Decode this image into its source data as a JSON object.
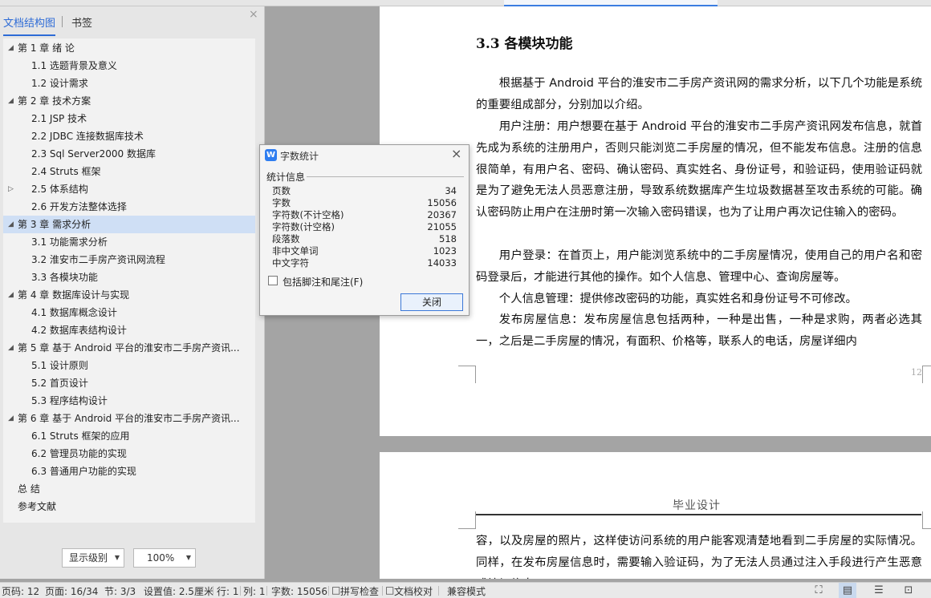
{
  "nav": {
    "tab_toc": "文档结构图",
    "tab_bookmark": "书签",
    "close": "×",
    "items": [
      {
        "twisty": "◢",
        "label": "第 1 章  绪  论"
      },
      {
        "twisty": "",
        "label": "1.1 选题背景及意义"
      },
      {
        "twisty": "",
        "label": "1.2 设计需求"
      },
      {
        "twisty": "◢",
        "label": "第 2 章  技术方案"
      },
      {
        "twisty": "",
        "label": "2.1 JSP 技术"
      },
      {
        "twisty": "",
        "label": "2.2 JDBC 连接数据库技术"
      },
      {
        "twisty": "",
        "label": "2.3 Sql Server2000 数据库"
      },
      {
        "twisty": "",
        "label": "2.4 Struts 框架"
      },
      {
        "twisty": "▷",
        "label": "2.5  体系结构"
      },
      {
        "twisty": "",
        "label": "2.6  开发方法整体选择"
      },
      {
        "twisty": "◢",
        "label": "第 3 章  需求分析"
      },
      {
        "twisty": "",
        "label": "3.1 功能需求分析"
      },
      {
        "twisty": "",
        "label": "3.2  淮安市二手房产资讯网流程"
      },
      {
        "twisty": "",
        "label": "3.3  各模块功能"
      },
      {
        "twisty": "◢",
        "label": "第 4 章  数据库设计与实现"
      },
      {
        "twisty": "",
        "label": "4.1 数据库概念设计"
      },
      {
        "twisty": "",
        "label": "4.2 数据库表结构设计"
      },
      {
        "twisty": "◢",
        "label": "第 5 章  基于 Android 平台的淮安市二手房产资讯..."
      },
      {
        "twisty": "",
        "label": "5.1  设计原则"
      },
      {
        "twisty": "",
        "label": "5.2  首页设计"
      },
      {
        "twisty": "",
        "label": "5.3  程序结构设计"
      },
      {
        "twisty": "◢",
        "label": "第 6 章  基于 Android 平台的淮安市二手房产资讯..."
      },
      {
        "twisty": "",
        "label": "6.1 Struts 框架的应用"
      },
      {
        "twisty": "",
        "label": "6.2 管理员功能的实现"
      },
      {
        "twisty": "",
        "label": "6.3 普通用户功能的实现"
      },
      {
        "twisty": "",
        "label": "总  结"
      },
      {
        "twisty": "",
        "label": "参考文献"
      }
    ],
    "level_select": "显示级别",
    "zoom_select": "100%"
  },
  "document": {
    "heading": "3.3  各模块功能",
    "page1_paragraphs": [
      "根据基于 Android 平台的淮安市二手房产资讯网的需求分析，以下几个功能是系统的重要组成部分，分别加以介绍。",
      "用户注册：用户想要在基于 Android 平台的淮安市二手房产资讯网发布信息，就首先成为系统的注册用户，否则只能浏览二手房屋的情况，但不能发布信息。注册的信息很简单，有用户名、密码、确认密码、真实姓名、身份证号，和验证码，使用验证码就是为了避免无法人员恶意注册，导致系统数据库产生垃圾数据甚至攻击系统的可能。确认密码防止用户在注册时第一次输入密码错误，也为了让用户再次记住输入的密码。",
      "用户登录：在首页上，用户能浏览系统中的二手房屋情况，使用自己的用户名和密码登录后，才能进行其他的操作。如个人信息、管理中心、查询房屋等。",
      "个人信息管理：提供修改密码的功能，真实姓名和身份证号不可修改。",
      "发布房屋信息：发布房屋信息包括两种，一种是出售，一种是求购，两者必选其一，之后是二手房屋的情况，有面积、价格等，联系人的电话，房屋详细内"
    ],
    "page_number": "12",
    "page2_header": "毕业设计",
    "page2_paragraph": "容，以及房屋的照片，这样使访问系统的用户能客观清楚地看到二手房屋的实际情况。同样，在发布房屋信息时，需要输入验证码，为了无法人员通过注入手段进行产生恶意式垃圾信息。"
  },
  "dialog": {
    "icon_letter": "W",
    "title": "字数统计",
    "close": "×",
    "group_label": "统计信息",
    "stats": [
      {
        "label": "页数",
        "value": "34"
      },
      {
        "label": "字数",
        "value": "15056"
      },
      {
        "label": "字符数(不计空格)",
        "value": "20367"
      },
      {
        "label": "字符数(计空格)",
        "value": "21055"
      },
      {
        "label": "段落数",
        "value": "518"
      },
      {
        "label": "非中文单词",
        "value": "1023"
      },
      {
        "label": "中文字符",
        "value": "14033"
      }
    ],
    "checkbox_label": "包括脚注和尾注(F)",
    "close_button": "关闭"
  },
  "status": {
    "page_code": "页码: 12",
    "page": "页面: 16/34",
    "section": "节: 3/3",
    "setting": "设置值: 2.5厘米",
    "row": "行: 1",
    "col": "列: 1",
    "words": "字数: 15056",
    "spell": "拼写检查",
    "proof": "文档校对",
    "compat": "兼容模式"
  }
}
